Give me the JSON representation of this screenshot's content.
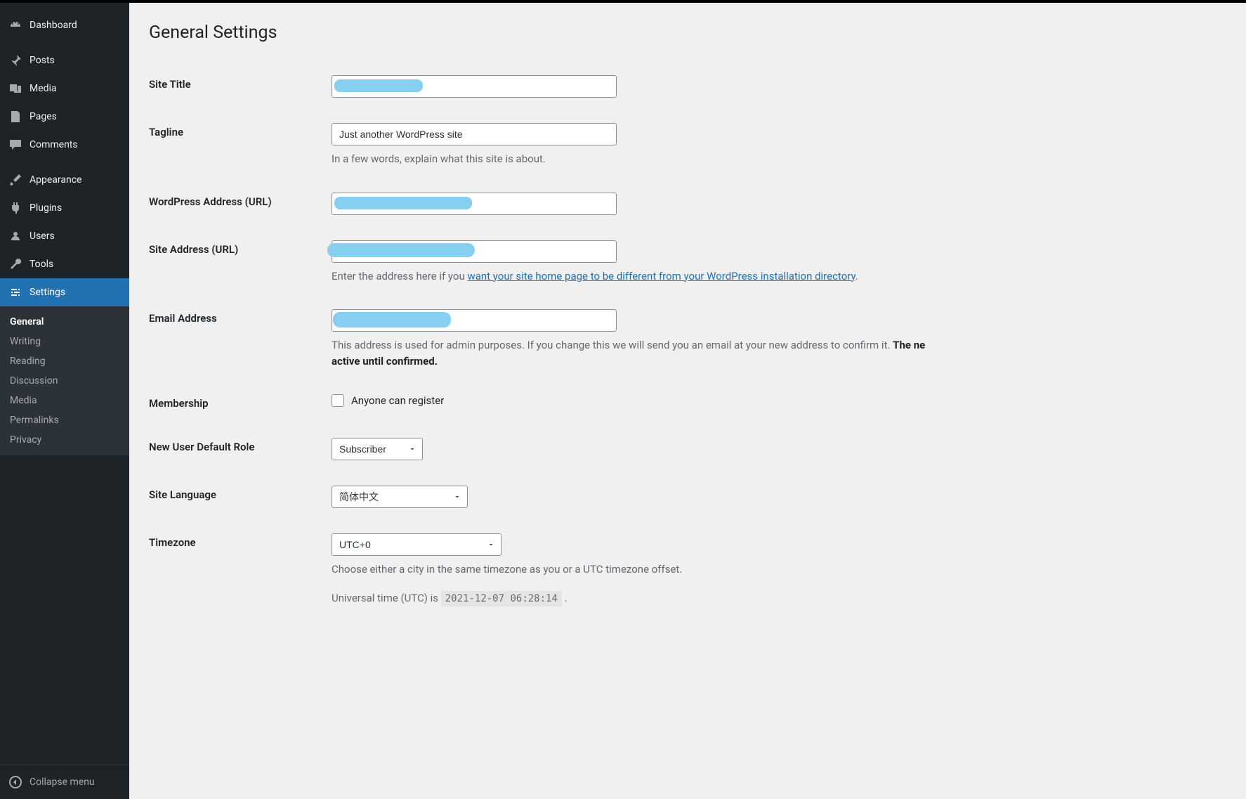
{
  "sidebar": {
    "dashboard": "Dashboard",
    "posts": "Posts",
    "media": "Media",
    "pages": "Pages",
    "comments": "Comments",
    "appearance": "Appearance",
    "plugins": "Plugins",
    "users": "Users",
    "tools": "Tools",
    "settings": "Settings",
    "submenu": {
      "general": "General",
      "writing": "Writing",
      "reading": "Reading",
      "discussion": "Discussion",
      "media": "Media",
      "permalinks": "Permalinks",
      "privacy": "Privacy"
    },
    "collapse": "Collapse menu"
  },
  "page": {
    "title": "General Settings"
  },
  "form": {
    "site_title": {
      "label": "Site Title",
      "value": ""
    },
    "tagline": {
      "label": "Tagline",
      "value": "Just another WordPress site",
      "desc": "In a few words, explain what this site is about."
    },
    "wp_address": {
      "label": "WordPress Address (URL)",
      "value": ""
    },
    "site_address": {
      "label": "Site Address (URL)",
      "value": "",
      "desc_prefix": "Enter the address here if you ",
      "desc_link": "want your site home page to be different from your WordPress installation directory",
      "desc_suffix": "."
    },
    "email": {
      "label": "Email Address",
      "value": "",
      "desc_part1": "This address is used for admin purposes. If you change this we will send you an email at your new address to confirm it. ",
      "desc_bold1": "The ne",
      "desc_bold2": "active until confirmed."
    },
    "membership": {
      "label": "Membership",
      "checkbox_label": "Anyone can register"
    },
    "default_role": {
      "label": "New User Default Role",
      "value": "Subscriber"
    },
    "language": {
      "label": "Site Language",
      "value": "简体中文"
    },
    "timezone": {
      "label": "Timezone",
      "value": "UTC+0",
      "desc1": "Choose either a city in the same timezone as you or a UTC timezone offset.",
      "desc2_prefix": "Universal time (UTC) is ",
      "utc_time": "2021-12-07 06:28:14",
      "desc2_suffix": " ."
    }
  }
}
